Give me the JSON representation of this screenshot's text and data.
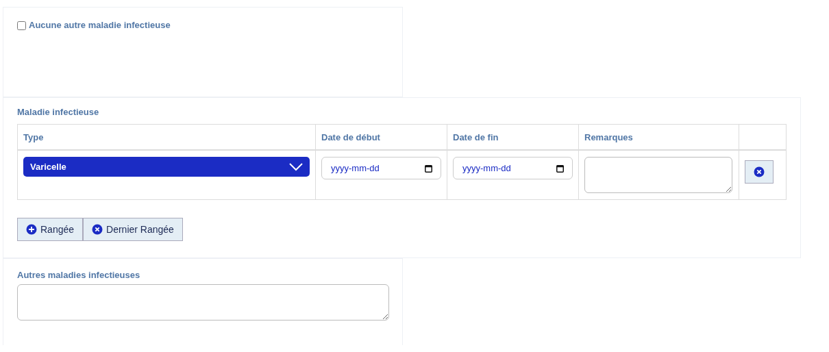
{
  "none_option": {
    "label": "Aucune autre maladie infectieuse",
    "checked": false
  },
  "infectious_disease": {
    "title": "Maladie infectieuse",
    "columns": [
      "Type",
      "Date de début",
      "Date de fin",
      "Remarques"
    ],
    "rows": [
      {
        "type": "Varicelle",
        "start_date": {
          "placeholder": "yyyy-mm-dd"
        },
        "end_date": {
          "placeholder": "yyyy-mm-dd"
        }
      }
    ],
    "buttons": [
      {
        "kind": "add",
        "label": "Rangée"
      },
      {
        "kind": "remove",
        "label": "Dernier Rangée"
      }
    ]
  },
  "other_diseases": {
    "label": "Autres maladies infectieuses"
  }
}
